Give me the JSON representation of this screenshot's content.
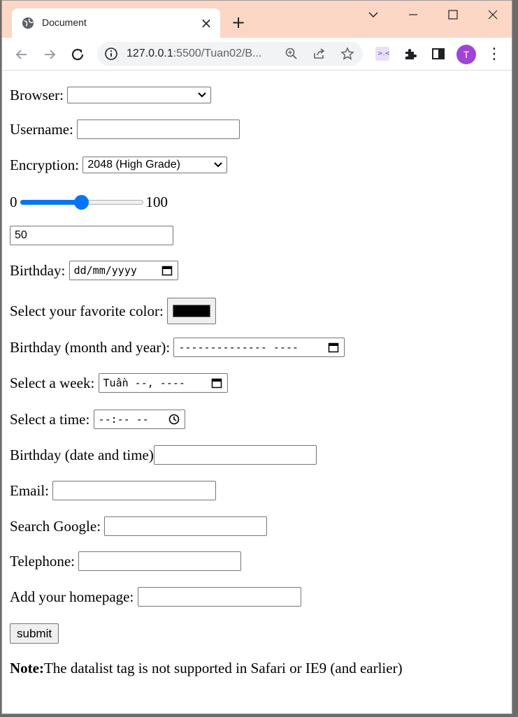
{
  "browser": {
    "tab_title": "Document",
    "url_host": "127.0.0.1",
    "url_rest": ":5500/Tuan02/B...",
    "profile_initial": "T"
  },
  "form": {
    "browser_label": "Browser:",
    "browser_value": "",
    "username_label": "Username:",
    "username_value": "",
    "encryption_label": "Encryption:",
    "encryption_value": "2048 (High Grade)",
    "range_min": "0",
    "range_max": "100",
    "range_value": 50,
    "range_output": "50",
    "birthday_label": "Birthday:",
    "birthday_placeholder": "dd/mm/yyyy",
    "color_label": "Select your favorite color:",
    "color_value": "#000000",
    "month_label": "Birthday (month and year):",
    "month_placeholder": "-------------- ----",
    "week_label": "Select a week:",
    "week_placeholder": "Tuần --, ----",
    "time_label": "Select a time:",
    "time_placeholder": "--:-- --",
    "datetime_label": "Birthday (date and time)",
    "datetime_value": "",
    "email_label": "Email:",
    "email_value": "",
    "search_label": "Search Google:",
    "search_value": "",
    "telephone_label": "Telephone:",
    "telephone_value": "",
    "homepage_label": "Add your homepage:",
    "homepage_value": "",
    "submit_label": "submit",
    "note_bold": "Note:",
    "note_text": " The datalist tag is not supported in Safari or IE9 (and earlier)"
  },
  "colors": {
    "titlebar": "#fdd7c5",
    "accent": "#0075ff",
    "avatar": "#a142d9"
  },
  "icons": [
    "globe-icon",
    "close-icon",
    "plus-icon",
    "chevron-down-icon",
    "minimize-icon",
    "maximize-icon",
    "window-close-icon",
    "back-icon",
    "forward-icon",
    "reload-icon",
    "info-icon",
    "zoom-icon",
    "share-icon",
    "star-icon",
    "extension-icon",
    "puzzle-icon",
    "sidepanel-icon",
    "menu-icon",
    "calendar-icon",
    "clock-icon"
  ]
}
